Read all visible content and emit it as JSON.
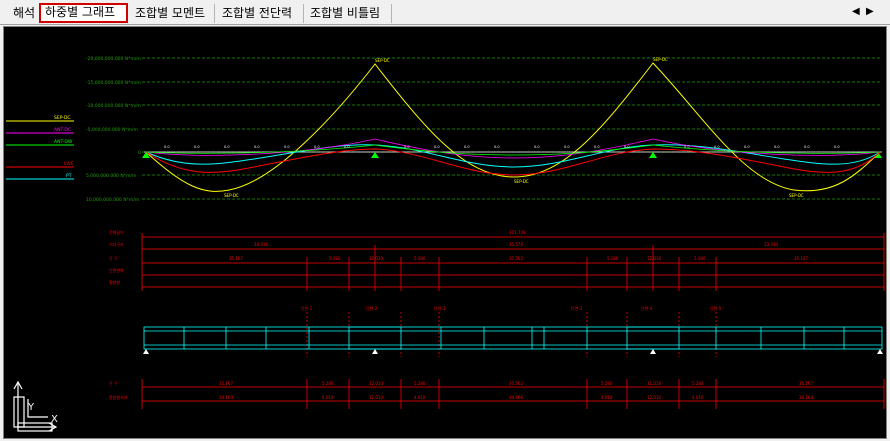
{
  "tabs": [
    "해석",
    "하중별 그래프",
    "조합별 모멘트",
    "조합별 전단력",
    "조합별 비틀림"
  ],
  "active_tab": 1,
  "nav": {
    "prev": "◀",
    "next": "▶"
  },
  "colors": {
    "background": "#000000",
    "grid": "#1ea000",
    "env_upper": "#ffff00",
    "red": "#ff0000",
    "cyan": "#00ffff",
    "magenta": "#ff00ff",
    "white": "#ffffff",
    "green": "#00ff00",
    "tab_highlight": "#d00000"
  },
  "graph": {
    "y_labels": [
      "-20,000,000.000 N*m/m",
      "-15,000,000.000 N*m/m",
      "-10,000,000.000 N*m/m",
      "-5,000,000.000 N*m/m",
      "0",
      "5,000,000.000 N*m/m",
      "10,000,000.000 N*m/m"
    ],
    "legend": [
      "SEP-DC",
      "ANT-DC",
      "ANT-DW",
      "LIVE",
      "PT"
    ],
    "peak_labels": [
      "SEP-DC",
      "SEP-DC",
      "SEP-DC",
      "SEP-DC",
      "SEP-DC"
    ]
  },
  "dimension_rows": {
    "labels": [
      "전체길이",
      "거더구조",
      "단 구",
      "단면변화",
      "횡방향"
    ],
    "total": "101.739",
    "row2": [
      "33.314",
      "35.576",
      "33.314"
    ],
    "row3": [
      "35.167",
      "5.280",
      "12.010",
      "5.280",
      "37.562",
      "5.280",
      "12.016",
      "5.280",
      "35.167"
    ]
  },
  "section_labels": [
    "단면-1",
    "단면-2",
    "단면-3",
    "단면-3",
    "단면-4",
    "단면-5"
  ],
  "bottom_dims": {
    "labels": [
      "단 구",
      "종방향거리"
    ],
    "row1": [
      "35.167",
      "5.280",
      "12.010",
      "5.280",
      "37.562",
      "5.280",
      "12.016",
      "5.280",
      "35.167"
    ],
    "row2": [
      "34.164",
      "4.010",
      "12.010",
      "4.010",
      "34.166",
      "4.010",
      "12.016",
      "4.010",
      "34.164"
    ]
  },
  "axis": {
    "x": "X",
    "y": "Y"
  }
}
